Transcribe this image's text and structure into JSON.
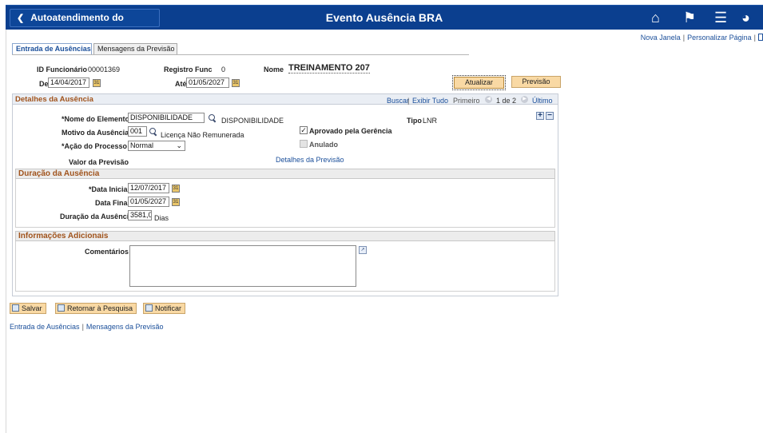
{
  "header": {
    "back_label": "Autoatendimento do Gerente",
    "title": "Evento Ausência BRA",
    "icons": [
      "home-icon",
      "flag-icon",
      "menu-icon",
      "navbar-icon"
    ]
  },
  "top_links": {
    "new_window": "Nova Janela",
    "personalize": "Personalizar Página"
  },
  "tabs": [
    {
      "label": "Entrada de Ausências",
      "active": true
    },
    {
      "label": "Mensagens da Previsão",
      "active": false
    }
  ],
  "employee": {
    "id_label": "ID Funcionário",
    "id_value": "00001369",
    "reg_label": "Registro Func",
    "reg_value": "0",
    "name_label": "Nome",
    "name_value": "TREINAMENTO 207",
    "from_label": "De",
    "from_value": "14/04/2017",
    "to_label": "Até",
    "to_value": "01/05/2027"
  },
  "buttons": {
    "update": "Atualizar",
    "forecast": "Previsão"
  },
  "details": {
    "title": "Detalhes da Ausência",
    "find": "Buscar",
    "view_all": "Exibir Tudo",
    "first": "Primeiro",
    "pager": "1 de 2",
    "last": "Último",
    "element_label": "*Nome do Elemento",
    "element_value": "DISPONIBILIDADE",
    "element_desc": "DISPONIBILIDADE",
    "type_label": "Tipo",
    "type_value": "LNR",
    "reason_label": "Motivo da Ausência",
    "reason_value": "001",
    "reason_desc": "Licença Não Remunerada",
    "approved_label": "Aprovado pela Gerência",
    "approved_checked": true,
    "action_label": "*Ação do Processo",
    "action_value": "Normal",
    "cancelled_label": "Anulado",
    "cancelled_checked": false,
    "forecast_value_label": "Valor da Previsão",
    "forecast_details_link": "Detalhes da Previsão"
  },
  "duration": {
    "title": "Duração da Ausência",
    "start_label": "*Data Inicial",
    "start_value": "12/07/2017",
    "end_label": "Data Final",
    "end_value": "01/05/2027",
    "dur_label": "Duração da Ausência",
    "dur_value": "3581,0",
    "dur_unit": "Dias"
  },
  "additional": {
    "title": "Informações Adicionais",
    "comments_label": "Comentários",
    "comments_value": ""
  },
  "toolbar": {
    "save": "Salvar",
    "return": "Retornar à Pesquisa",
    "notify": "Notificar"
  },
  "bottom_links": {
    "entry": "Entrada de Ausências",
    "messages": "Mensagens da Previsão"
  }
}
